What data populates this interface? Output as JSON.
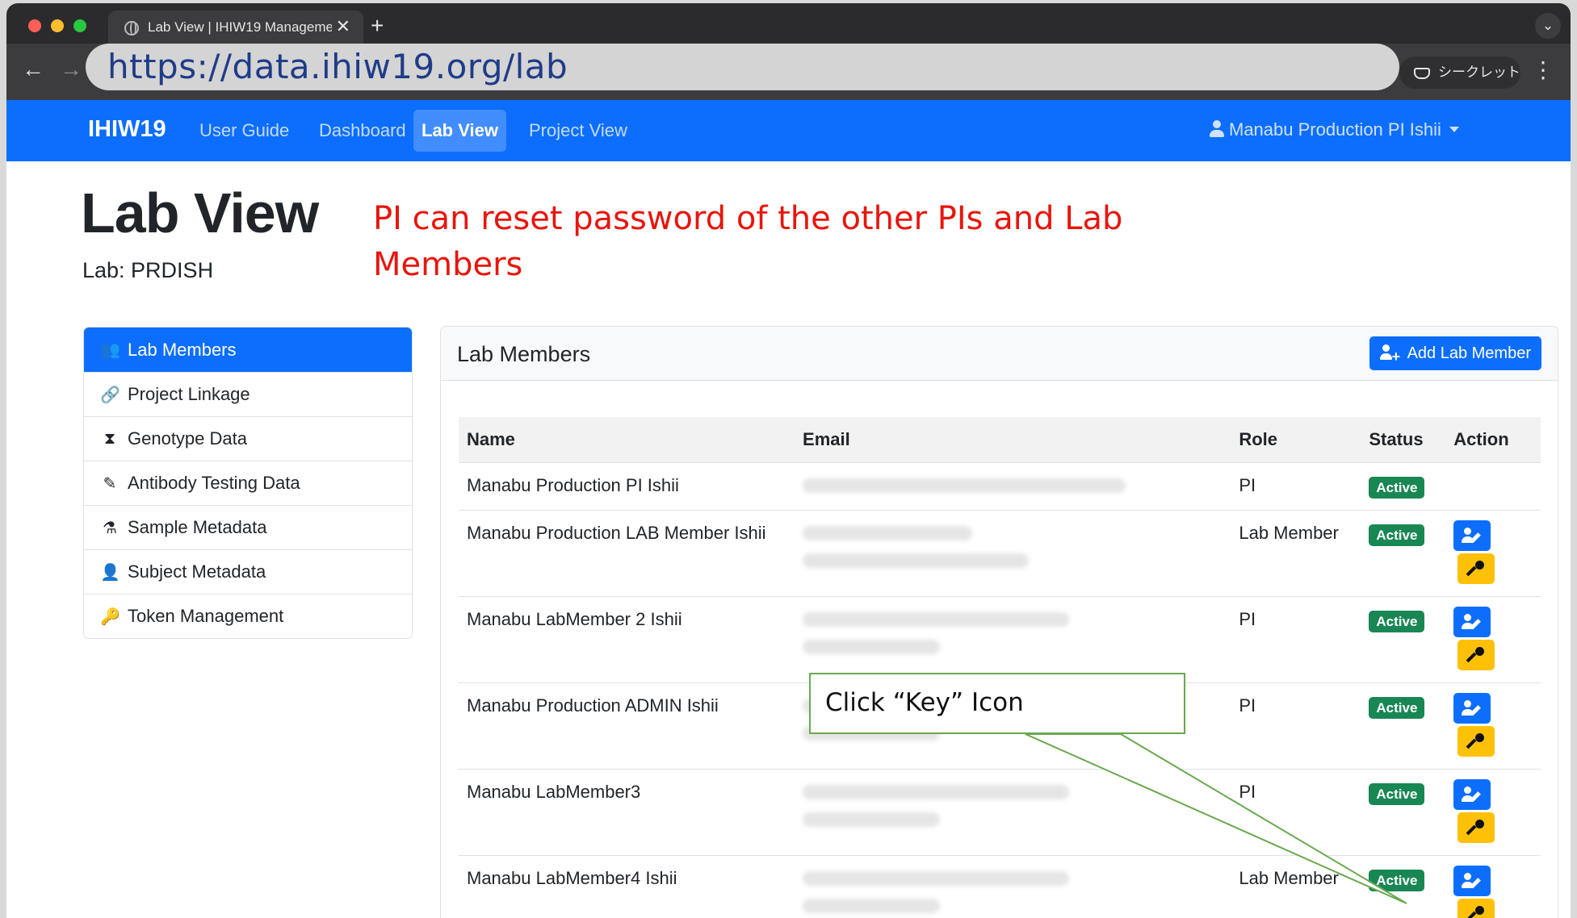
{
  "browser": {
    "tab_title": "Lab View | IHIW19 Manageme",
    "tab_close": "✕",
    "new_tab": "+",
    "tab_menu": "⌄",
    "url": "https://data.ihiw19.org/lab",
    "incognito_label": "シークレット",
    "back": "←",
    "forward": "→",
    "menu": "⋮"
  },
  "navbar": {
    "brand": "IHIW19",
    "links": [
      "User Guide",
      "Dashboard",
      "Lab View",
      "Project View"
    ],
    "active": "Lab View",
    "user": "Manabu Production PI Ishii"
  },
  "page": {
    "title": "Lab View",
    "lab_label": "Lab: PRDISH"
  },
  "annotation": {
    "text": "PI can reset password of the other PIs and Lab Members",
    "color": "#e8150c"
  },
  "sidebar": {
    "items": [
      {
        "label": "Lab Members",
        "icon": "users-icon",
        "glyph": "👥"
      },
      {
        "label": "Project Linkage",
        "icon": "link-icon",
        "glyph": "🔗"
      },
      {
        "label": "Genotype Data",
        "icon": "hourglass-icon",
        "glyph": "⧗"
      },
      {
        "label": "Antibody Testing Data",
        "icon": "pen-icon",
        "glyph": "✎"
      },
      {
        "label": "Sample Metadata",
        "icon": "flask-icon",
        "glyph": "⚗"
      },
      {
        "label": "Subject Metadata",
        "icon": "user-icon",
        "glyph": "👤"
      },
      {
        "label": "Token Management",
        "icon": "key-icon",
        "glyph": "🔑"
      }
    ]
  },
  "card": {
    "title": "Lab Members",
    "add_button": "Add Lab Member"
  },
  "table": {
    "headers": [
      "Name",
      "Email",
      "Role",
      "Status",
      "Action"
    ],
    "rows": [
      {
        "name": "Manabu Production PI Ishii",
        "role": "PI",
        "status": "Active",
        "actions": false
      },
      {
        "name": "Manabu Production LAB Member Ishii",
        "role": "Lab Member",
        "status": "Active",
        "actions": true
      },
      {
        "name": "Manabu LabMember 2 Ishii",
        "role": "PI",
        "status": "Active",
        "actions": true
      },
      {
        "name": "Manabu Production ADMIN Ishii",
        "role": "PI",
        "status": "Active",
        "actions": true
      },
      {
        "name": "Manabu LabMember3",
        "role": "PI",
        "status": "Active",
        "actions": true
      },
      {
        "name": "Manabu LabMember4 Ishii",
        "role": "Lab Member",
        "status": "Active",
        "actions": true
      }
    ]
  },
  "callout": {
    "text": "Click “Key” Icon",
    "border_color": "#6aa84f"
  },
  "colors": {
    "primary": "#0d6efd",
    "success": "#198754",
    "warning": "#ffc107"
  }
}
